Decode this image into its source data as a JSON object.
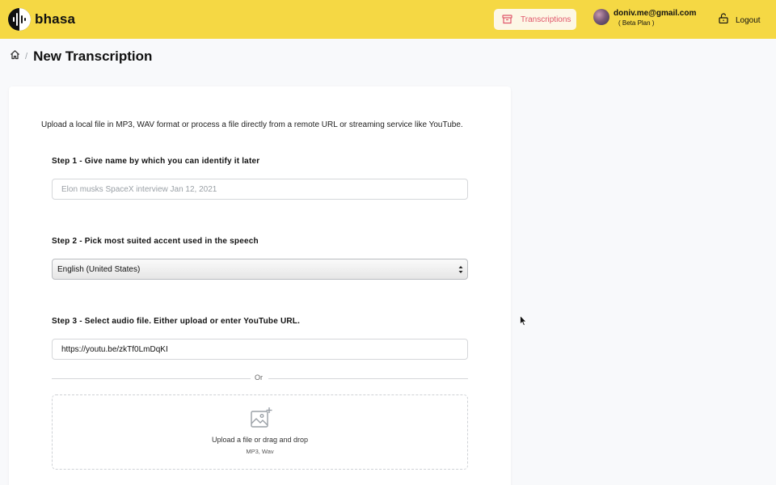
{
  "app": {
    "name": "bhasa"
  },
  "header": {
    "transcriptions_label": "Transcriptions",
    "user_email": "doniv.me@gmail.com",
    "user_plan": "( Beta Plan )",
    "logout_label": "Logout",
    "brand_color": "#f5d844"
  },
  "breadcrumb": {
    "separator": "/",
    "title": "New Transcription"
  },
  "form": {
    "intro": "Upload a local file in MP3, WAV format or process a file directly from a remote URL or streaming service like YouTube.",
    "step1": {
      "label": "Step 1 - Give name by which you can identify it later",
      "value": "",
      "placeholder": "Elon musks SpaceX interview Jan 12, 2021"
    },
    "step2": {
      "label": "Step 2 - Pick most suited accent used in the speech",
      "selected": "English (United States)"
    },
    "step3": {
      "label": "Step 3 - Select audio file. Either upload or enter YouTube URL.",
      "url_value": "https://youtu.be/zkTf0LmDqKI"
    },
    "or_label": "Or",
    "upload": {
      "label": "Upload a file  or drag and drop",
      "formats": "MP3, Wav"
    }
  },
  "icons": {
    "home": "home-icon",
    "transcriptions": "archive-box-icon",
    "logout": "unlock-icon",
    "upload": "image-add-icon"
  }
}
